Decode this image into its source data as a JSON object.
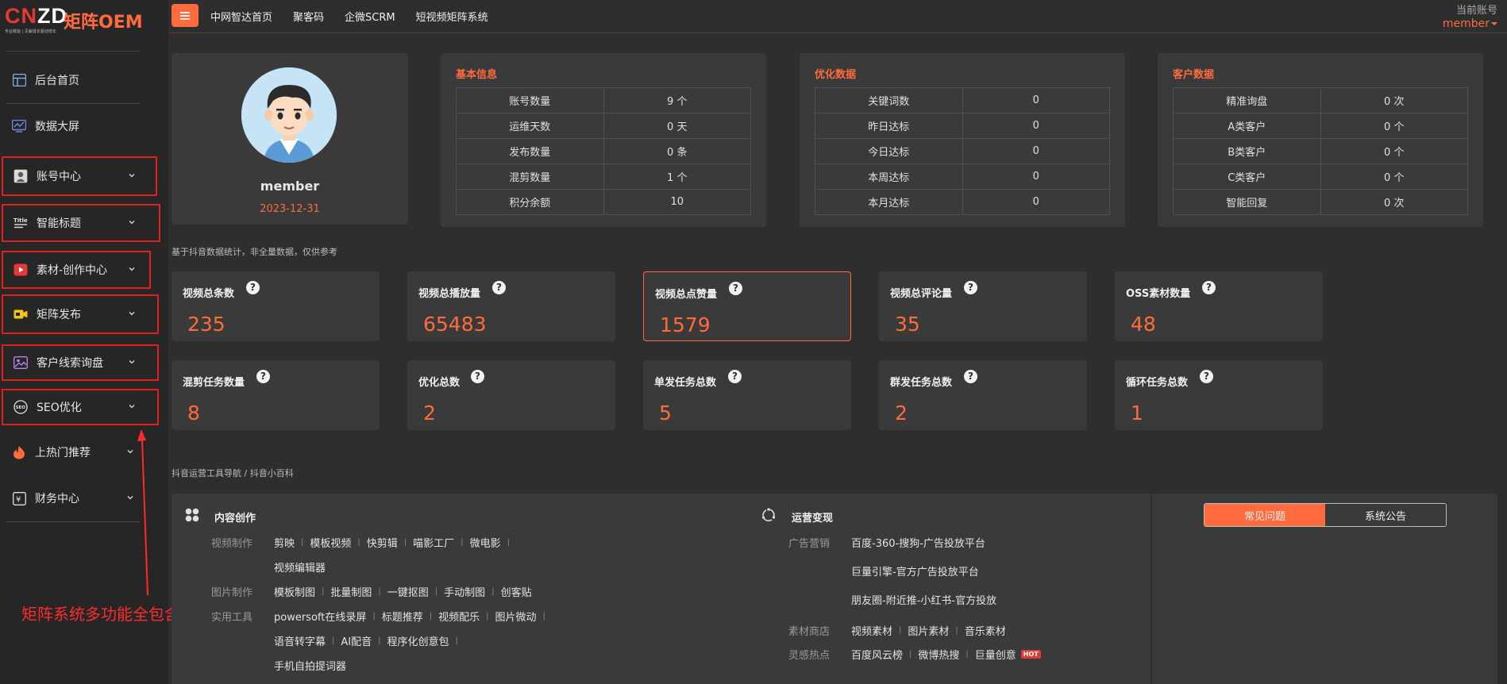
{
  "brand": {
    "mark_red": "CN",
    "mark_white": "ZD",
    "tagline": "专业赋能 | 见解成长驱动增长",
    "name": "矩阵OEM"
  },
  "topbar": {
    "nav": [
      "中网智达首页",
      "聚客码",
      "企微SCRM",
      "短视频矩阵系统"
    ],
    "account_label": "当前账号",
    "account_name": "member"
  },
  "sidebar": {
    "items": [
      {
        "label": "后台首页",
        "icon": "dashboard-icon"
      },
      {
        "label": "数据大屏",
        "icon": "chart-icon"
      },
      {
        "label": "账号中心",
        "icon": "user-card-icon"
      },
      {
        "label": "智能标题",
        "icon": "title-icon"
      },
      {
        "label": "素材-创作中心",
        "icon": "video-play-icon"
      },
      {
        "label": "矩阵发布",
        "icon": "camera-icon"
      },
      {
        "label": "客户线索询盘",
        "icon": "image-icon"
      },
      {
        "label": "SEO优化",
        "icon": "seo-icon"
      },
      {
        "label": "上热门推荐",
        "icon": "fire-icon"
      },
      {
        "label": "财务中心",
        "icon": "yen-icon"
      }
    ],
    "annotation": "矩阵系统多功能全包含"
  },
  "profile": {
    "name": "member",
    "date": "2023-12-31"
  },
  "basic_info": {
    "title": "基本信息",
    "rows": [
      [
        "账号数量",
        "9 个"
      ],
      [
        "运维天数",
        "0 天"
      ],
      [
        "发布数量",
        "0 条"
      ],
      [
        "混剪数量",
        "1 个"
      ],
      [
        "积分余额",
        "10"
      ]
    ]
  },
  "optimize_info": {
    "title": "优化数据",
    "rows": [
      [
        "关键词数",
        "0"
      ],
      [
        "昨日达标",
        "0"
      ],
      [
        "今日达标",
        "0"
      ],
      [
        "本周达标",
        "0"
      ],
      [
        "本月达标",
        "0"
      ]
    ]
  },
  "customer_info": {
    "title": "客户数据",
    "rows": [
      [
        "精准询盘",
        "0 次"
      ],
      [
        "A类客户",
        "0 个"
      ],
      [
        "B类客户",
        "0 个"
      ],
      [
        "C类客户",
        "0 个"
      ],
      [
        "智能回复",
        "0 次"
      ]
    ]
  },
  "stats_note": "基于抖音数据统计，非全量数据，仅供参考",
  "stats": [
    {
      "label": "视频总条数",
      "value": "235"
    },
    {
      "label": "视频总播放量",
      "value": "65483"
    },
    {
      "label": "视频总点赞量",
      "value": "1579"
    },
    {
      "label": "视频总评论量",
      "value": "35"
    },
    {
      "label": "OSS素材数量",
      "value": "48"
    },
    {
      "label": "混剪任务数量",
      "value": "8"
    },
    {
      "label": "优化总数",
      "value": "2"
    },
    {
      "label": "单发任务总数",
      "value": "5"
    },
    {
      "label": "群发任务总数",
      "value": "2"
    },
    {
      "label": "循环任务总数",
      "value": "1"
    }
  ],
  "tools_note": "抖音运营工具导航 / 抖音小百科",
  "content_creation": {
    "title": "内容创作",
    "video_cat": "视频制作",
    "video_links": [
      "剪映",
      "模板视频",
      "快剪辑",
      "喵影工厂",
      "微电影"
    ],
    "video_links2": [
      "视频编辑器"
    ],
    "image_cat": "图片制作",
    "image_links": [
      "模板制图",
      "批量制图",
      "一键抠图",
      "手动制图",
      "创客贴"
    ],
    "util_cat": "实用工具",
    "util_links": [
      "powersoft在线录屏",
      "标题推荐",
      "视频配乐",
      "图片微动"
    ],
    "util_links2": [
      "语音转字幕",
      "AI配音",
      "程序化创意包"
    ],
    "util_links3": [
      "手机自拍提词器"
    ]
  },
  "operations": {
    "title": "运营变现",
    "ad_cat": "广告营销",
    "ad_links": [
      "百度-360-搜狗-广告投放平台",
      "巨量引擎-官方广告投放平台",
      "朋友圈-附近推-小红书-官方投放"
    ],
    "store_cat": "素材商店",
    "store_links": [
      "视频素材",
      "图片素材",
      "音乐素材"
    ],
    "hot_cat": "灵感热点",
    "hot_links": [
      "百度风云榜",
      "微博热搜",
      "巨量创意"
    ],
    "hot_badge": "HOT"
  },
  "faq_tabs": [
    "常见问题",
    "系统公告"
  ],
  "colors": {
    "accent": "#ff6b3d",
    "annotation_red": "#e02020"
  }
}
